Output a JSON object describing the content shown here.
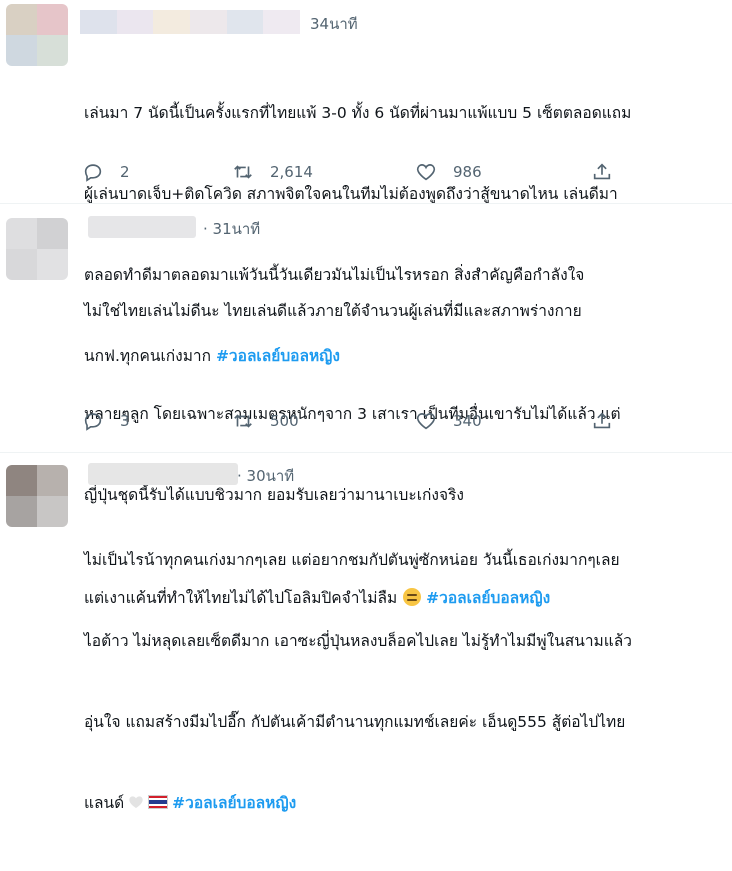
{
  "tweets": [
    {
      "time": "34นาที",
      "lines": [
        "เล่นมา 7 นัดนี้เป็นครั้งแรกที่ไทยแพ้ 3-0 ทั้ง 6 นัดที่ผ่านมาแพ้แบบ 5 เซ็ตตลอดแถม",
        "ผู้เล่นบาดเจ็บ+ติดโควิด สภาพจิตใจคนในทีมไม่ต้องพูดถึงว่าสู้ขนาดไหน เล่นดีมา",
        "ตลอดทำดีมาตลอดมาแพ้วันนี้วันเดียวมันไม่เป็นไรหรอก สิ่งสำคัญคือกำลังใจ"
      ],
      "last_line_text": "นกฟ.ทุกคนเก่งมาก ",
      "hashtag": "#วอลเลย์บอลหญิง",
      "replies": "2",
      "retweets": "2,614",
      "likes": "986"
    },
    {
      "time": "· 31นาที",
      "lines": [
        "ไม่ใช่ไทยเล่นไม่ดีนะ  ไทยเล่นดีแล้วภายใต้จำนวนผู้เล่นที่มีและสภาพร่างกาย",
        "",
        "หลายๆลูก โดยเฉพาะสามเมตรหนักๆจาก 3 เสาเรา  เป็นทีมอื่นเขารับไม่ได้แล้ว  แต่",
        "ญี่ปุ่นชุดนี้รับได้แบบชิวมาก   ยอมรับเลยว่ามานาเบะเก่งจริง",
        ""
      ],
      "last_line_text": "แต่เงาแค้นที่ทำให้ไทยไม่ได้ไปโอลิมปิคจำไม่ลืม",
      "hashtag": "#วอลเลย์บอลหญิง",
      "replies": "3",
      "retweets": "500",
      "likes": "340"
    },
    {
      "time": "· 30นาที",
      "lines": [
        "ไม่เป็นไรน้าทุกคนเก่งมากๆเลย แต่อยากชมกัปตันพู่ซักหน่อย วันนี้เธอเก่งมากๆเลย",
        "ไอต้าว ไม่หลุดเลยเซ็ตดีมาก เอาซะญี่ปุ่นหลงบล็อคไปเลย ไม่รู้ทำไมมีพู่ในสนามแล้ว",
        "อุ่นใจ แถมสร้างมีมไปอี๊ก กัปตันเค้ามีตำนานทุกแมทช์เลยค่ะ เอ็นดู555 สู้ต่อไปไทย"
      ],
      "last_line_text": "แลนด์",
      "hashtag": "#วอลเลย์บอลหญิง"
    }
  ],
  "icons": {
    "reply": "reply-icon",
    "retweet": "retweet-icon",
    "like": "heart-icon",
    "share": "share-icon"
  },
  "colors": {
    "hashtag": "#1d9bf0",
    "muted": "#536471",
    "text": "#0f1419"
  }
}
